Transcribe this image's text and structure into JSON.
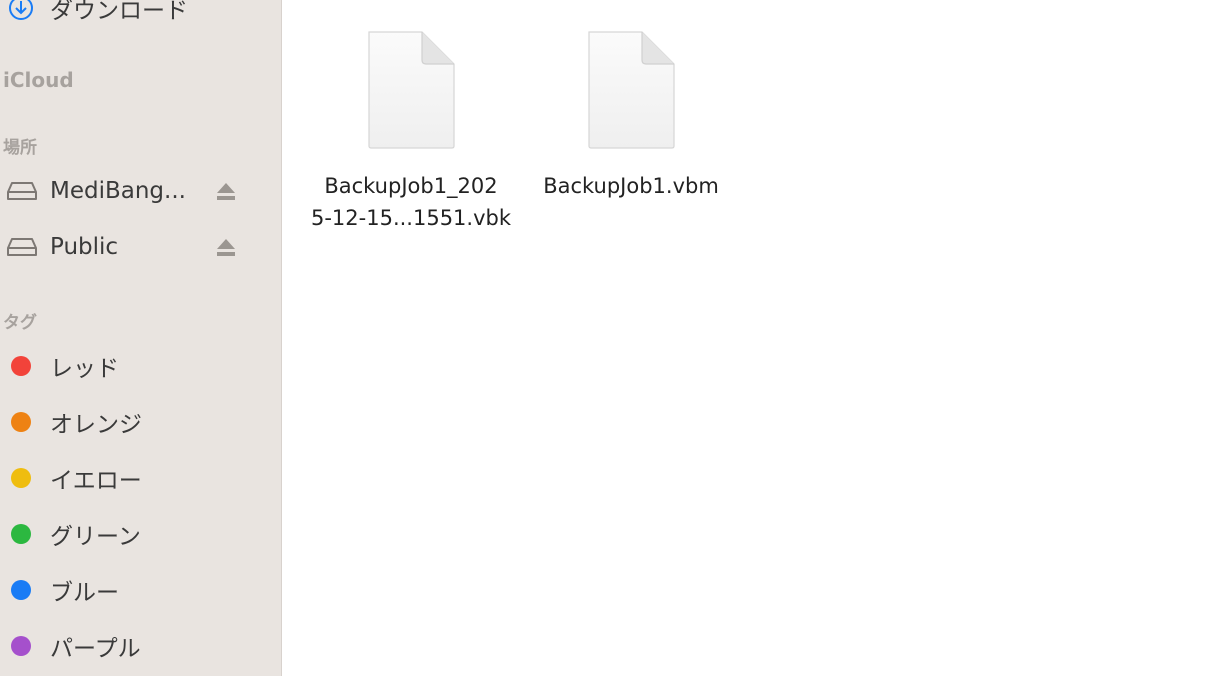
{
  "sidebar": {
    "downloads_label": "ダウンロード",
    "icloud_header": "iCloud",
    "locations_header": "場所",
    "locations": [
      {
        "label": "MediBang...",
        "icon": "drive-icon",
        "ejectable": true
      },
      {
        "label": "Public",
        "icon": "drive-icon",
        "ejectable": true
      }
    ],
    "tags_header": "タグ",
    "tags": [
      {
        "label": "レッド",
        "color": "#f2433a"
      },
      {
        "label": "オレンジ",
        "color": "#ee8213"
      },
      {
        "label": "イエロー",
        "color": "#efbd0f"
      },
      {
        "label": "グリーン",
        "color": "#2cb840"
      },
      {
        "label": "ブルー",
        "color": "#1a7cf5"
      },
      {
        "label": "パープル",
        "color": "#a550cc"
      }
    ]
  },
  "files": [
    {
      "name_line1": "BackupJob1_202",
      "name_line2": "5-12-15...1551.vbk",
      "icon": "document-icon"
    },
    {
      "name_line1": "BackupJob1.vbm",
      "name_line2": "",
      "icon": "document-icon"
    }
  ],
  "colors": {
    "sidebar_bg": "#e9e4e0",
    "accent": "#1a7cf5"
  }
}
